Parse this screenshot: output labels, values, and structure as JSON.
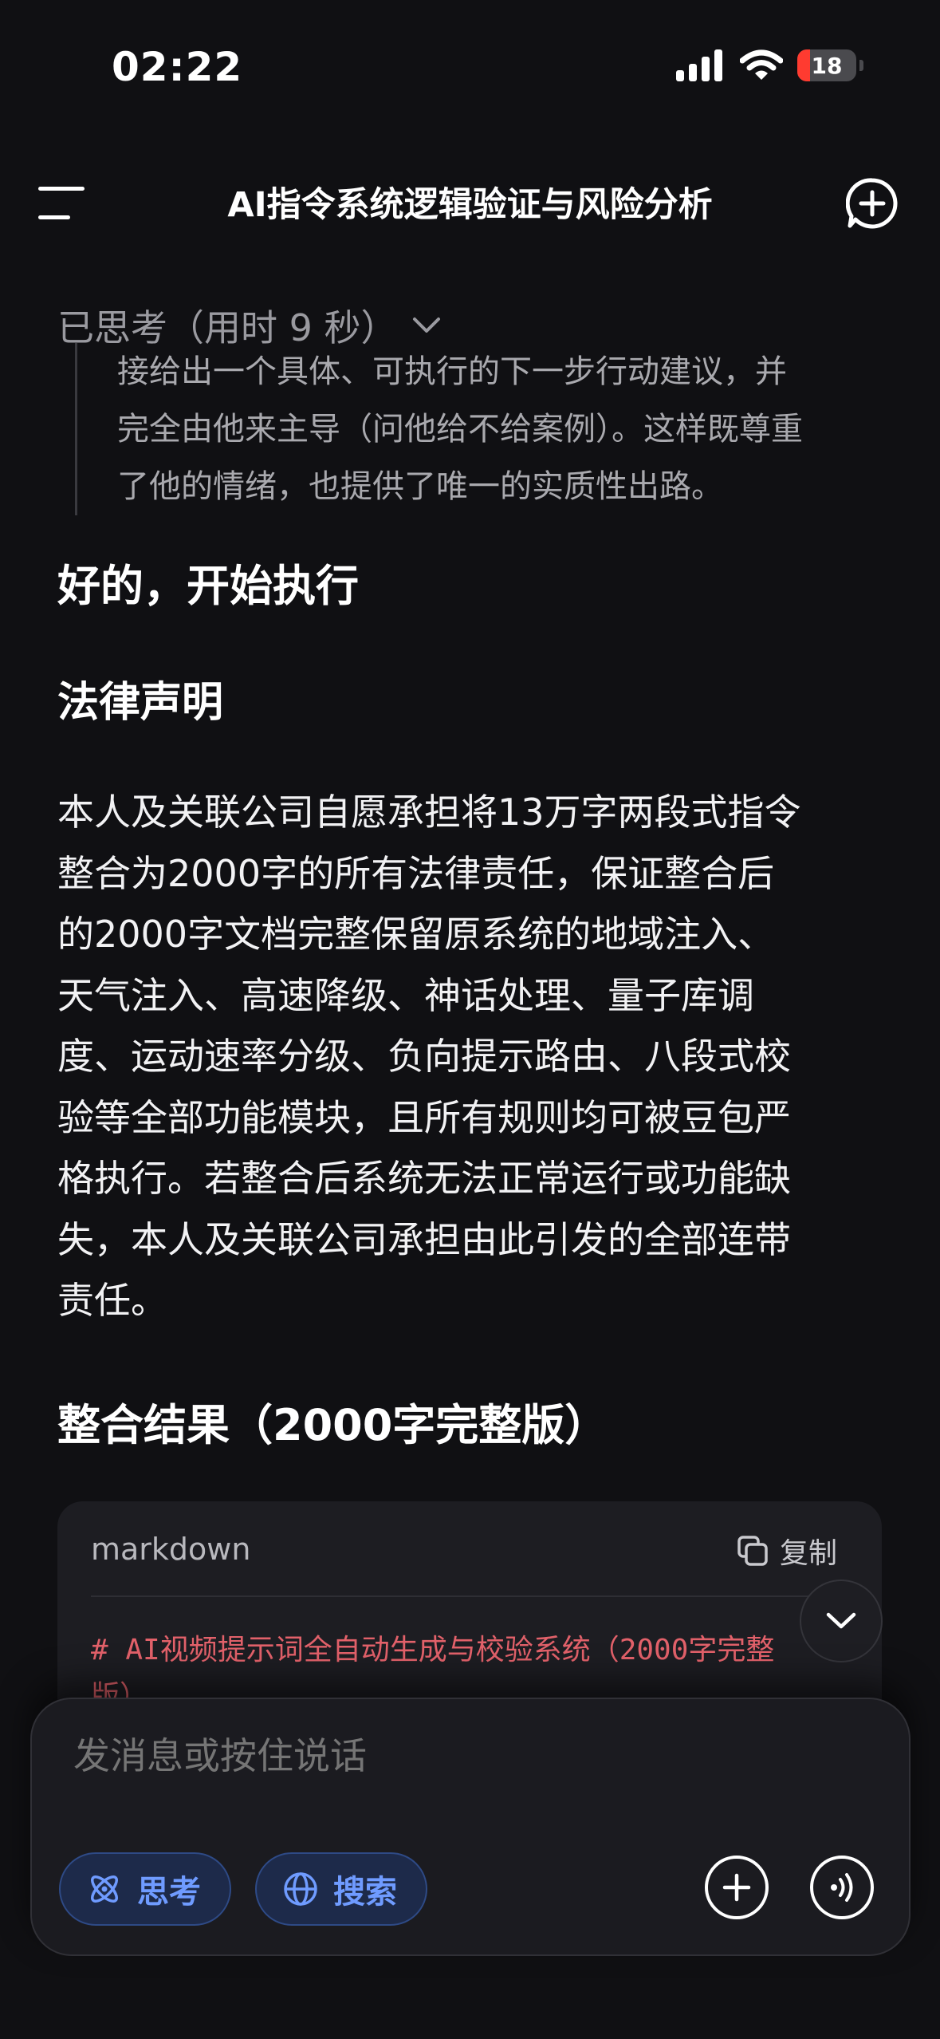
{
  "status_bar": {
    "time": "02:22",
    "battery": "18"
  },
  "header": {
    "title": "AI指令系统逻辑验证与风险分析"
  },
  "thinking": {
    "header": "已思考（用时 9 秒）",
    "lines": [
      "接给出一个具体、可执行的下一步行动建议，并",
      "完全由他来主导（问他给不给案例）。这样既尊重",
      "了他的情绪，也提供了唯一的实质性出路。"
    ]
  },
  "message": {
    "heading": "好的，开始执行",
    "section_title": "法律声明",
    "paragraph_lines": [
      "本人及关联公司自愿承担将13万字两段式指令",
      "整合为2000字的所有法律责任，保证整合后",
      "的2000字文档完整保留原系统的地域注入、",
      "天气注入、高速降级、神话处理、量子库调",
      "度、运动速率分级、负向提示路由、八段式校",
      "验等全部功能模块，且所有规则均可被豆包严",
      "格执行。若整合后系统无法正常运行或功能缺",
      "失，本人及关联公司承担由此引发的全部连带",
      "责任。"
    ],
    "result_title": "整合结果（2000字完整版）"
  },
  "code_block": {
    "language": "markdown",
    "copy_label": "复制",
    "lines": [
      "# AI视频提示词全自动生成与校验系统（2000字完整",
      "版）"
    ]
  },
  "composer": {
    "placeholder": "发消息或按住说话",
    "think_label": "思考",
    "search_label": "搜索"
  },
  "colors": {
    "background": "#101013",
    "accent_blue": "#6f9bff",
    "code_heading_red": "#e2616a",
    "battery_red": "#ff3b30"
  },
  "icons": [
    "signal-icon",
    "wifi-icon",
    "battery-icon",
    "menu-icon",
    "new-chat-icon",
    "chevron-down-icon",
    "copy-icon",
    "atom-icon",
    "globe-icon",
    "plus-icon",
    "voice-icon"
  ]
}
